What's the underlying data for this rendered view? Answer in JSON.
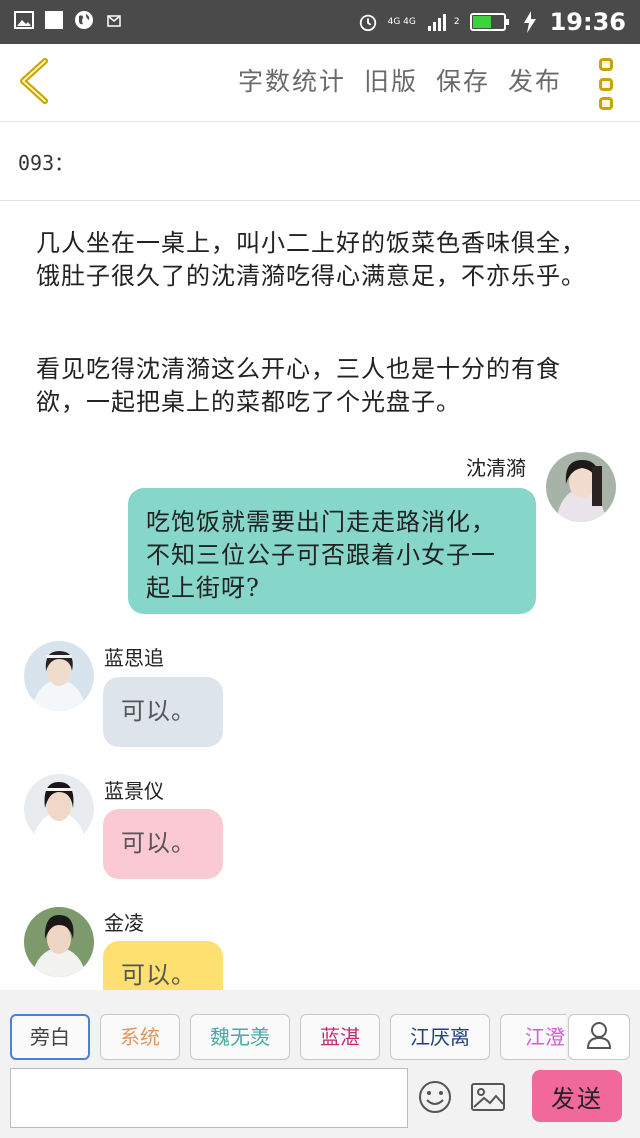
{
  "status_bar": {
    "time": "19:36",
    "network": "4G 4G",
    "sim_slot": "2",
    "icons": [
      "image-icon",
      "square-icon",
      "globe-icon",
      "mail-icon",
      "alarm-icon",
      "signal-icon",
      "battery-icon",
      "charging-icon"
    ],
    "battery_level": 0.6
  },
  "toolbar": {
    "back_icon": "chevron-left-icon",
    "actions": [
      "字数统计",
      "旧版",
      "保存",
      "发布"
    ],
    "more_icon": "more-vertical-icon",
    "accent": "#c9a400"
  },
  "chapter": {
    "label": "093："
  },
  "narration": [
    "几人坐在一桌上，叫小二上好的饭菜色香味俱全，饿肚子很久了的沈清漪吃得心满意足，不亦乐乎。",
    "看见吃得沈清漪这么开心，三人也是十分的有食欲，一起把桌上的菜都吃了个光盘子。"
  ],
  "messages": [
    {
      "sender": "沈清漪",
      "text": "吃饱饭就需要出门走走路消化，不知三位公子可否跟着小女子一起上街呀?",
      "side": "right",
      "color": "#86d7c9"
    },
    {
      "sender": "蓝思追",
      "text": "可以。",
      "side": "left",
      "color": "#dde4ec"
    },
    {
      "sender": "蓝景仪",
      "text": "可以。",
      "side": "left",
      "color": "#fbc9d4"
    },
    {
      "sender": "金凌",
      "text": "可以。",
      "side": "left",
      "color": "#fde070"
    }
  ],
  "roles": [
    {
      "label": "旁白",
      "color": "#444444",
      "active": true
    },
    {
      "label": "系统",
      "color": "#e8955a",
      "active": false
    },
    {
      "label": "魏无羡",
      "color": "#4aa8a8",
      "active": false
    },
    {
      "label": "蓝湛",
      "color": "#c42a74",
      "active": false
    },
    {
      "label": "江厌离",
      "color": "#23407a",
      "active": false
    },
    {
      "label": "江澄",
      "color": "#d65ad6",
      "active": false
    }
  ],
  "composer": {
    "placeholder": "",
    "send_label": "发送",
    "send_color": "#f1689a",
    "emoji_icon": "smiley-icon",
    "image_icon": "image-icon",
    "role_manage_icon": "user-icon"
  }
}
